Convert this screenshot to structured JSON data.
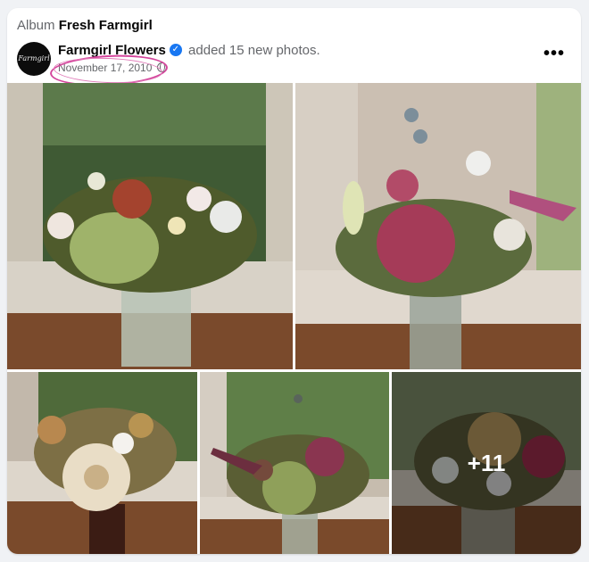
{
  "album": {
    "prefix": "Album",
    "name": "Fresh Farmgirl"
  },
  "post": {
    "avatar_text": "Farmgirl",
    "page_name": "Farmgirl Flowers",
    "verified_icon": "✓",
    "action_text": "added 15 new photos.",
    "date": "November 17, 2010",
    "more_icon": "•••"
  },
  "grid": {
    "more_count": "+11"
  },
  "colors": {
    "highlight": "#d4459c",
    "verified": "#1877f2"
  }
}
